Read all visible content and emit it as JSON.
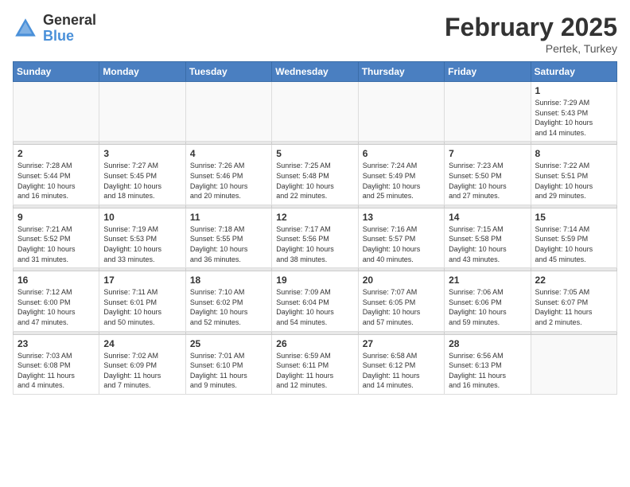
{
  "header": {
    "logo_general": "General",
    "logo_blue": "Blue",
    "month_title": "February 2025",
    "location": "Pertek, Turkey"
  },
  "weekdays": [
    "Sunday",
    "Monday",
    "Tuesday",
    "Wednesday",
    "Thursday",
    "Friday",
    "Saturday"
  ],
  "weeks": [
    [
      {
        "day": "",
        "info": ""
      },
      {
        "day": "",
        "info": ""
      },
      {
        "day": "",
        "info": ""
      },
      {
        "day": "",
        "info": ""
      },
      {
        "day": "",
        "info": ""
      },
      {
        "day": "",
        "info": ""
      },
      {
        "day": "1",
        "info": "Sunrise: 7:29 AM\nSunset: 5:43 PM\nDaylight: 10 hours\nand 14 minutes."
      }
    ],
    [
      {
        "day": "2",
        "info": "Sunrise: 7:28 AM\nSunset: 5:44 PM\nDaylight: 10 hours\nand 16 minutes."
      },
      {
        "day": "3",
        "info": "Sunrise: 7:27 AM\nSunset: 5:45 PM\nDaylight: 10 hours\nand 18 minutes."
      },
      {
        "day": "4",
        "info": "Sunrise: 7:26 AM\nSunset: 5:46 PM\nDaylight: 10 hours\nand 20 minutes."
      },
      {
        "day": "5",
        "info": "Sunrise: 7:25 AM\nSunset: 5:48 PM\nDaylight: 10 hours\nand 22 minutes."
      },
      {
        "day": "6",
        "info": "Sunrise: 7:24 AM\nSunset: 5:49 PM\nDaylight: 10 hours\nand 25 minutes."
      },
      {
        "day": "7",
        "info": "Sunrise: 7:23 AM\nSunset: 5:50 PM\nDaylight: 10 hours\nand 27 minutes."
      },
      {
        "day": "8",
        "info": "Sunrise: 7:22 AM\nSunset: 5:51 PM\nDaylight: 10 hours\nand 29 minutes."
      }
    ],
    [
      {
        "day": "9",
        "info": "Sunrise: 7:21 AM\nSunset: 5:52 PM\nDaylight: 10 hours\nand 31 minutes."
      },
      {
        "day": "10",
        "info": "Sunrise: 7:19 AM\nSunset: 5:53 PM\nDaylight: 10 hours\nand 33 minutes."
      },
      {
        "day": "11",
        "info": "Sunrise: 7:18 AM\nSunset: 5:55 PM\nDaylight: 10 hours\nand 36 minutes."
      },
      {
        "day": "12",
        "info": "Sunrise: 7:17 AM\nSunset: 5:56 PM\nDaylight: 10 hours\nand 38 minutes."
      },
      {
        "day": "13",
        "info": "Sunrise: 7:16 AM\nSunset: 5:57 PM\nDaylight: 10 hours\nand 40 minutes."
      },
      {
        "day": "14",
        "info": "Sunrise: 7:15 AM\nSunset: 5:58 PM\nDaylight: 10 hours\nand 43 minutes."
      },
      {
        "day": "15",
        "info": "Sunrise: 7:14 AM\nSunset: 5:59 PM\nDaylight: 10 hours\nand 45 minutes."
      }
    ],
    [
      {
        "day": "16",
        "info": "Sunrise: 7:12 AM\nSunset: 6:00 PM\nDaylight: 10 hours\nand 47 minutes."
      },
      {
        "day": "17",
        "info": "Sunrise: 7:11 AM\nSunset: 6:01 PM\nDaylight: 10 hours\nand 50 minutes."
      },
      {
        "day": "18",
        "info": "Sunrise: 7:10 AM\nSunset: 6:02 PM\nDaylight: 10 hours\nand 52 minutes."
      },
      {
        "day": "19",
        "info": "Sunrise: 7:09 AM\nSunset: 6:04 PM\nDaylight: 10 hours\nand 54 minutes."
      },
      {
        "day": "20",
        "info": "Sunrise: 7:07 AM\nSunset: 6:05 PM\nDaylight: 10 hours\nand 57 minutes."
      },
      {
        "day": "21",
        "info": "Sunrise: 7:06 AM\nSunset: 6:06 PM\nDaylight: 10 hours\nand 59 minutes."
      },
      {
        "day": "22",
        "info": "Sunrise: 7:05 AM\nSunset: 6:07 PM\nDaylight: 11 hours\nand 2 minutes."
      }
    ],
    [
      {
        "day": "23",
        "info": "Sunrise: 7:03 AM\nSunset: 6:08 PM\nDaylight: 11 hours\nand 4 minutes."
      },
      {
        "day": "24",
        "info": "Sunrise: 7:02 AM\nSunset: 6:09 PM\nDaylight: 11 hours\nand 7 minutes."
      },
      {
        "day": "25",
        "info": "Sunrise: 7:01 AM\nSunset: 6:10 PM\nDaylight: 11 hours\nand 9 minutes."
      },
      {
        "day": "26",
        "info": "Sunrise: 6:59 AM\nSunset: 6:11 PM\nDaylight: 11 hours\nand 12 minutes."
      },
      {
        "day": "27",
        "info": "Sunrise: 6:58 AM\nSunset: 6:12 PM\nDaylight: 11 hours\nand 14 minutes."
      },
      {
        "day": "28",
        "info": "Sunrise: 6:56 AM\nSunset: 6:13 PM\nDaylight: 11 hours\nand 16 minutes."
      },
      {
        "day": "",
        "info": ""
      }
    ]
  ]
}
